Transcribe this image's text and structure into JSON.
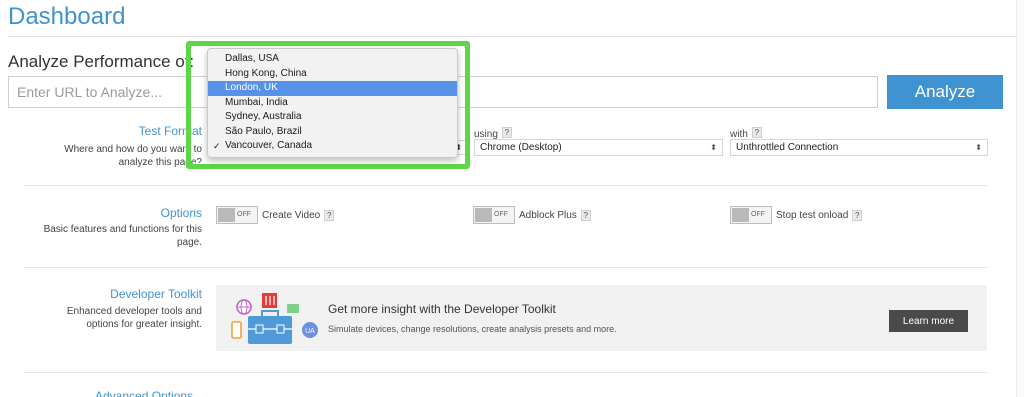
{
  "page": {
    "title": "Dashboard"
  },
  "analyze": {
    "label": "Analyze Performance of:",
    "url_placeholder": "Enter URL to Analyze...",
    "button_label": "Analyze"
  },
  "test_format": {
    "title": "Test Format",
    "description_line1": "Where and how do you want to",
    "description_line2": "analyze this page?",
    "browser": {
      "label": "using",
      "help": "?",
      "value": "Chrome (Desktop)"
    },
    "connection": {
      "label": "with",
      "help": "?",
      "value": "Unthrottled Connection"
    }
  },
  "location_dropdown": {
    "items": [
      {
        "label": "Dallas, USA"
      },
      {
        "label": "Hong Kong, China"
      },
      {
        "label": "London, UK"
      },
      {
        "label": "Mumbai, India"
      },
      {
        "label": "Sydney, Australia"
      },
      {
        "label": "São Paulo, Brazil"
      },
      {
        "label": "Vancouver, Canada"
      }
    ],
    "hovered": "London, UK",
    "checked": "Vancouver, Canada",
    "check_glyph": "✓",
    "highlight_color": "#5ed64a"
  },
  "options": {
    "title": "Options",
    "description_line1": "Basic features and functions for this",
    "description_line2": "page.",
    "toggle_state_text": "OFF",
    "help": "?",
    "toggles": [
      {
        "label": "Create Video"
      },
      {
        "label": "Adblock Plus"
      },
      {
        "label": "Stop test onload"
      }
    ]
  },
  "developer_toolkit": {
    "title": "Developer Toolkit",
    "description_line1": "Enhanced developer tools and",
    "description_line2": "options for greater insight.",
    "banner_heading": "Get more insight with the Developer Toolkit",
    "banner_subtext": "Simulate devices, change resolutions, create analysis presets and more.",
    "illustration_badge": "UA",
    "learn_more": "Learn more"
  },
  "advanced_options": {
    "title": "Advanced Options"
  },
  "colors": {
    "accent": "#3f93d1",
    "selection": "#5891e8",
    "dark_button": "#4a4a4a"
  }
}
